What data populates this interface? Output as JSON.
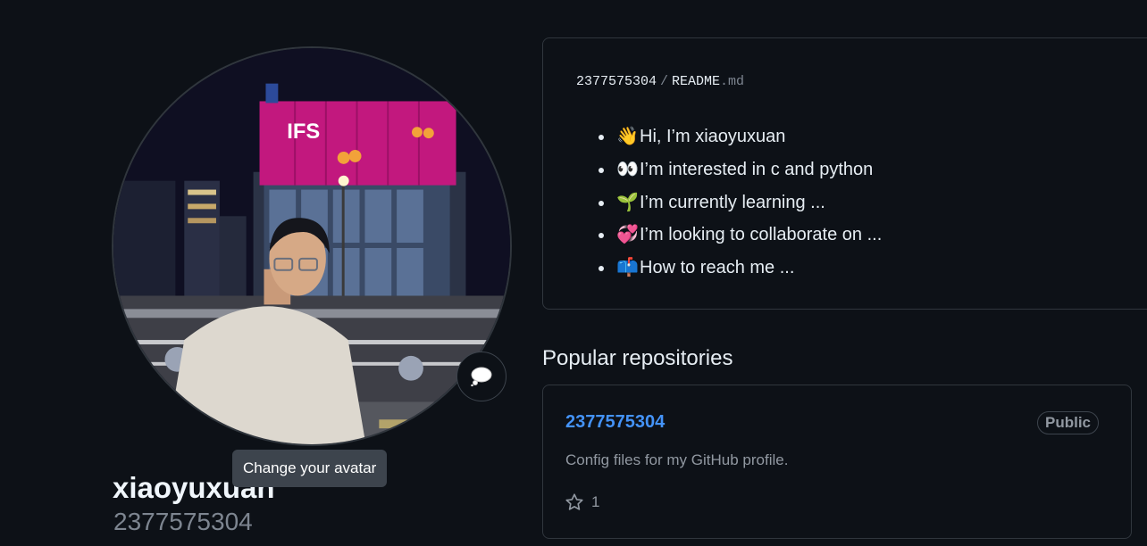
{
  "profile": {
    "display_name": "xiaoyuxuan",
    "login": "2377575304",
    "avatar_tooltip": "Change your avatar",
    "status_icon": "thought-bubble-icon"
  },
  "readme": {
    "owner": "2377575304",
    "separator": "/",
    "file_base": "README",
    "file_ext": ".md",
    "items": [
      {
        "emoji": "👋",
        "text": "Hi, I’m xiaoyuxuan"
      },
      {
        "emoji": "👀",
        "text": "I’m interested in c and python"
      },
      {
        "emoji": "🌱",
        "text": "I’m currently learning ..."
      },
      {
        "emoji": "💞️",
        "text": "I’m looking to collaborate on ..."
      },
      {
        "emoji": "📫",
        "text": "How to reach me ..."
      }
    ]
  },
  "popular": {
    "title": "Popular repositories",
    "repos": [
      {
        "name": "2377575304",
        "visibility": "Public",
        "description": "Config files for my GitHub profile.",
        "stars": "1"
      }
    ]
  },
  "colors": {
    "background": "#0d1117",
    "border": "#30363d",
    "link": "#4493f8",
    "muted": "#9198a1"
  }
}
